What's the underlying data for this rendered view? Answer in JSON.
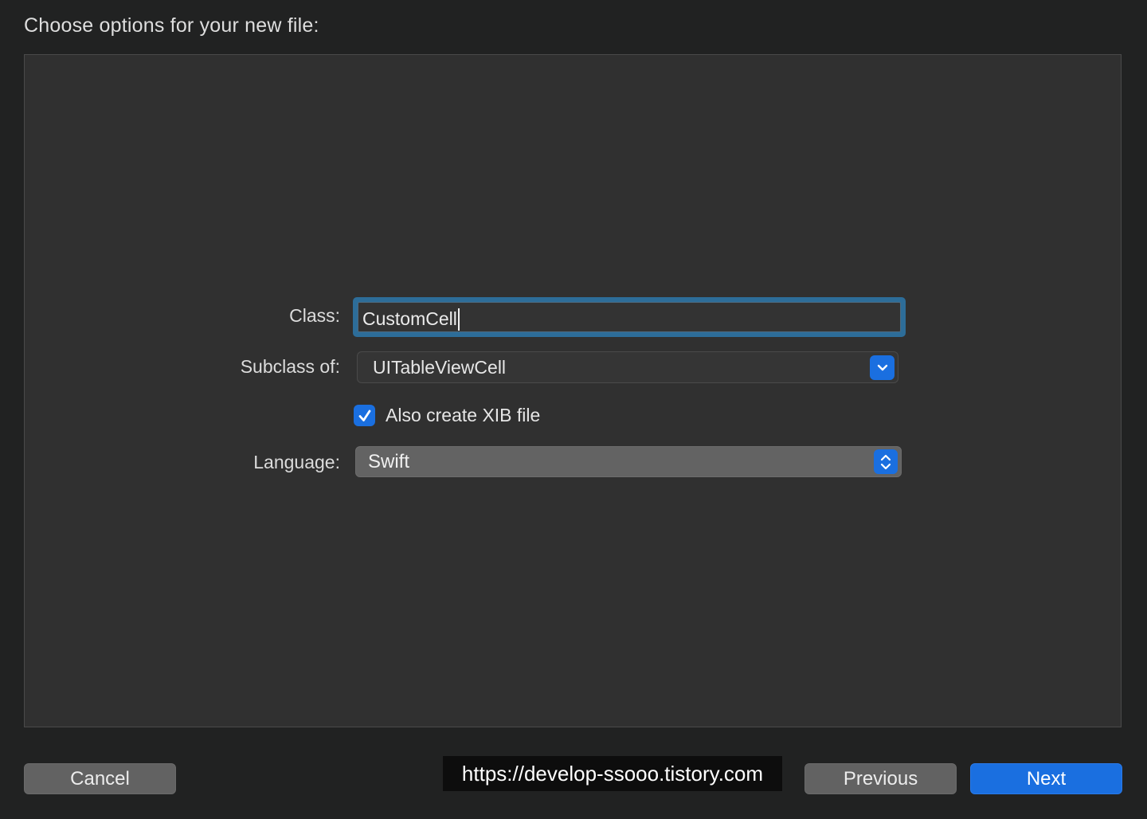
{
  "dialog": {
    "heading": "Choose options for your new file:"
  },
  "form": {
    "class_label": "Class:",
    "class_value": "CustomCell",
    "subclass_label": "Subclass of:",
    "subclass_value": "UITableViewCell",
    "xib_checkbox_label": "Also create XIB file",
    "xib_checked": true,
    "language_label": "Language:",
    "language_value": "Swift"
  },
  "buttons": {
    "cancel": "Cancel",
    "previous": "Previous",
    "next": "Next"
  },
  "watermark": {
    "text": "https://develop-ssooo.tistory.com"
  },
  "colors": {
    "background": "#212222",
    "panel": "#303030",
    "accent": "#1a6fe0",
    "focus_ring": "#2d6d99"
  },
  "icons": {
    "subclass_popup": "chevron-down-icon",
    "language_popup": "up-down-chevron-icon",
    "checkbox": "checkmark-icon"
  }
}
